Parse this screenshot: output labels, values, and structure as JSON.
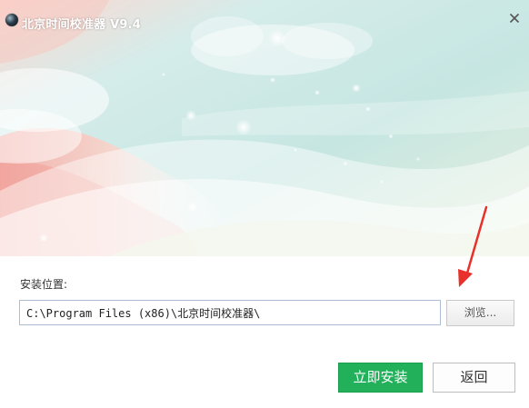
{
  "window": {
    "title": "北京时间校准器 V9.4",
    "close_icon": "close-icon",
    "app_icon": "globe-icon"
  },
  "form": {
    "location_label": "安装位置:",
    "path_value": "C:\\Program Files (x86)\\北京时间校准器\\",
    "browse_label": "浏览..."
  },
  "actions": {
    "install_label": "立即安装",
    "back_label": "返回"
  },
  "colors": {
    "install_button": "#22b15a",
    "annotation_arrow": "#e8312a"
  }
}
